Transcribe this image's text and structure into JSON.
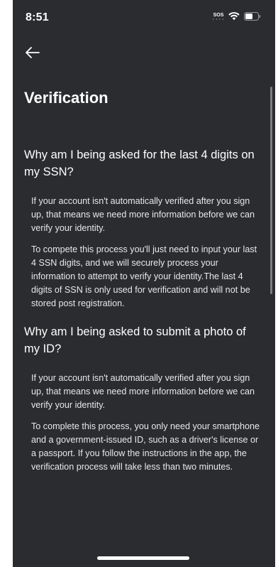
{
  "status_bar": {
    "time": "8:51",
    "sos": "SOS"
  },
  "header": {
    "back_icon": "arrow-left-icon",
    "title": "Verification"
  },
  "faq": [
    {
      "question": "Why am I being asked for the last 4 digits on my SSN?",
      "paragraphs": [
        "If your account isn't automatically verified after you sign up, that means we need more information before we can verify your identity.",
        "To compete this process you'll just need to input your last 4 SSN digits, and we will securely process your information to attempt to verify your identity.The last 4 digits of SSN is only used for verification and will not be stored post registration."
      ]
    },
    {
      "question": "Why am I being asked to submit a photo of my ID?",
      "paragraphs": [
        "If your account isn't automatically verified after you sign up, that means we need more information before we can verify your identity.",
        "To complete this process, you only need your smartphone and a government-issued ID, such as a driver's license or a passport. If you follow the instructions in the app, the verification process will take less than two minutes."
      ]
    }
  ],
  "colors": {
    "background": "#2b2c30",
    "text": "#ffffff",
    "scrollbar": "#7c7d82"
  }
}
